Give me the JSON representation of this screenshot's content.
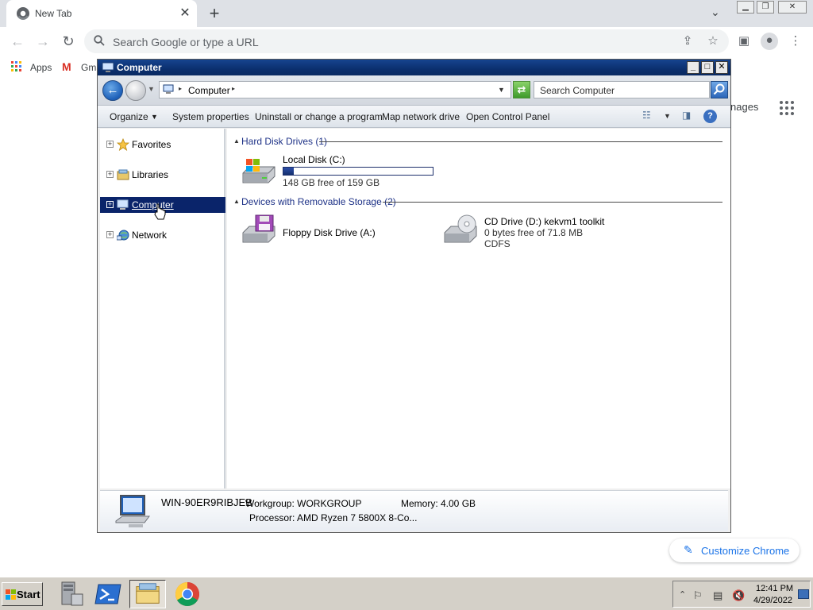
{
  "chrome": {
    "tab_title": "New Tab",
    "tab_close": "✕",
    "new_tab": "+",
    "tab_search": "⌄",
    "omnibox_placeholder": "Search Google or type a URL",
    "bookmarks": {
      "apps_label": "Apps",
      "gmail_label": "Gma"
    },
    "ntp_images_label": "nages",
    "customize_label": "Customize Chrome"
  },
  "explorer": {
    "title": "Computer",
    "address_text": "Computer",
    "search_placeholder": "Search Computer",
    "commands": [
      "Organize",
      "System properties",
      "Uninstall or change a program",
      "Map network drive",
      "Open Control Panel"
    ],
    "nav_items": [
      {
        "label": "Favorites",
        "icon": "star-icon",
        "selected": false
      },
      {
        "label": "Libraries",
        "icon": "libraries-icon",
        "selected": false
      },
      {
        "label": "Computer",
        "icon": "computer-icon",
        "selected": true
      },
      {
        "label": "Network",
        "icon": "network-icon",
        "selected": false
      }
    ],
    "groups": {
      "hard_disks": "Hard Disk Drives (1)",
      "removable": "Devices with Removable Storage (2)"
    },
    "drives": {
      "c": {
        "name": "Local Disk (C:)",
        "free_text": "148 GB free of 159 GB",
        "used_fraction": 0.07
      },
      "a": {
        "name": "Floppy Disk Drive (A:)"
      },
      "d": {
        "name": "CD Drive (D:) kekvm1 toolkit",
        "free_text": "0 bytes free of 71.8 MB",
        "fs": "CDFS"
      }
    },
    "details": {
      "computer_name": "WIN-90ER9RIBJEB",
      "workgroup": "Workgroup: WORKGROUP",
      "memory": "Memory: 4.00 GB",
      "processor": "Processor: AMD Ryzen 7 5800X 8-Co..."
    }
  },
  "taskbar": {
    "start_label": "Start",
    "time": "12:41 PM",
    "date": "4/29/2022"
  },
  "colors": {
    "selection": "#0a246a",
    "chrome_accent": "#1a73e8",
    "title_bar": "#0b2f6e"
  }
}
